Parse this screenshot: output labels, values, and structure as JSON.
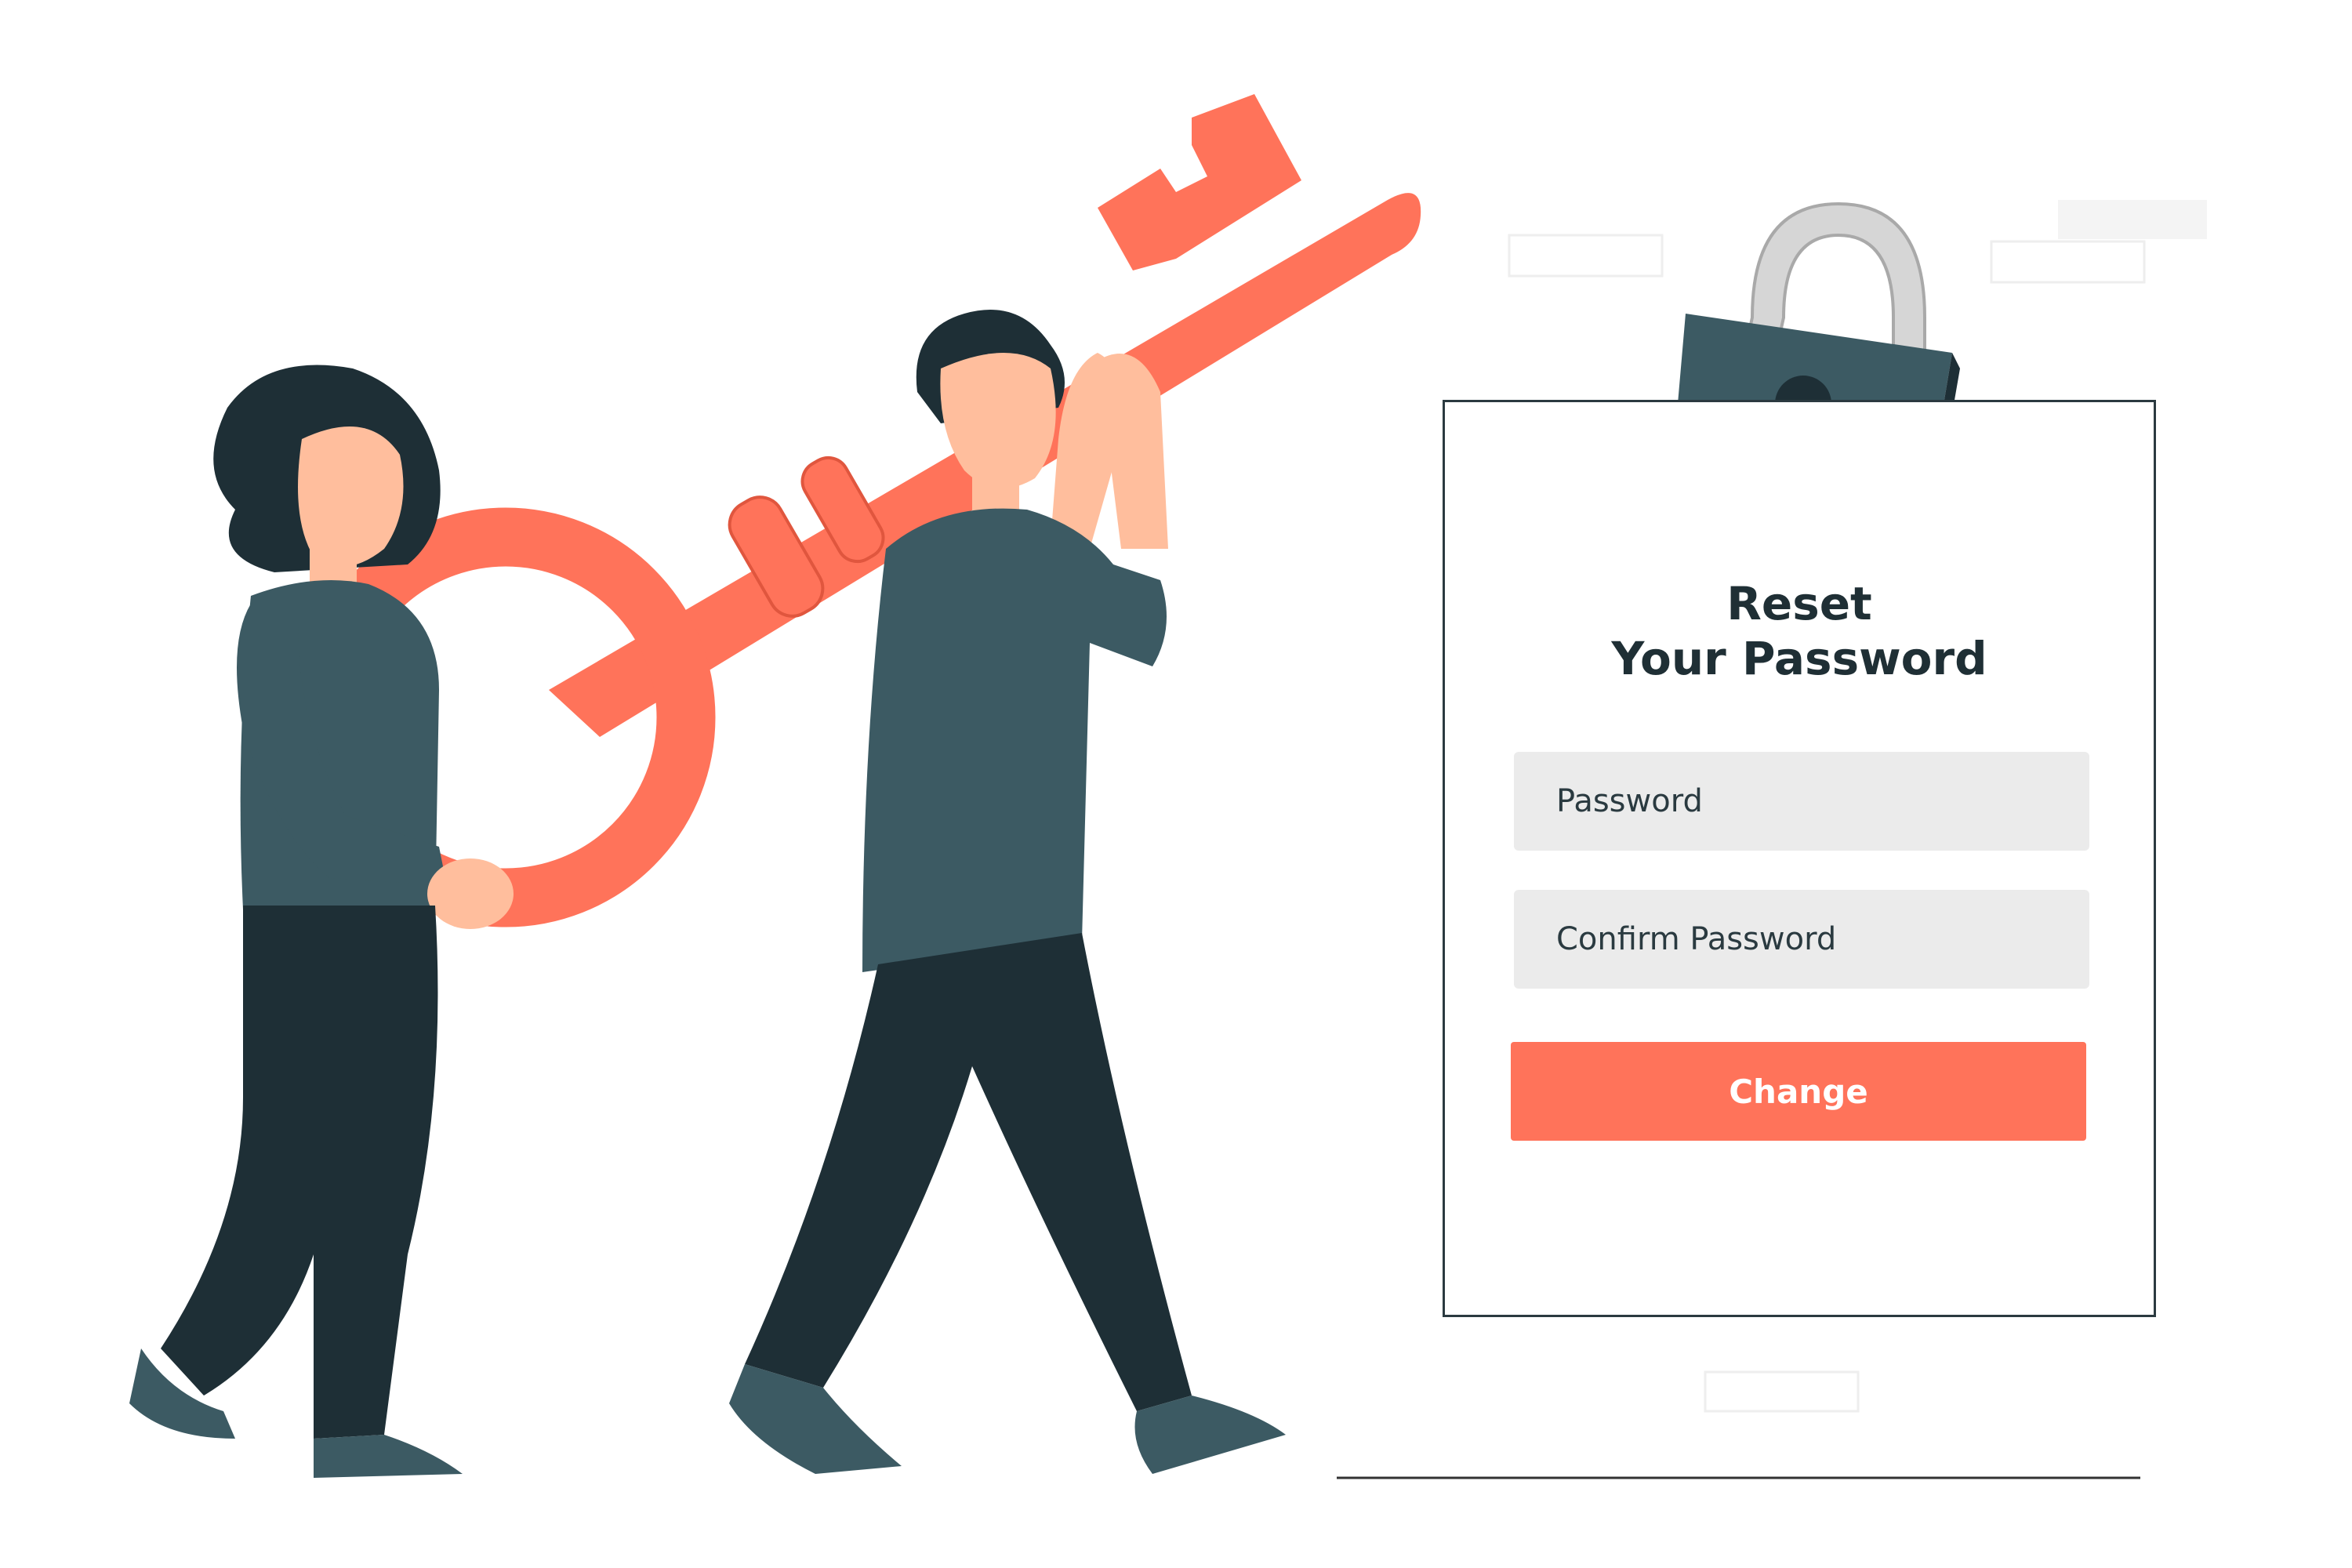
{
  "form": {
    "title_line1": "Reset",
    "title_line2": "Your Password",
    "password_placeholder": "Password",
    "confirm_placeholder": "Confirm Password",
    "submit_label": "Change"
  },
  "colors": {
    "accent": "#ff735a",
    "dark": "#1e2f36",
    "shirt": "#3c5a63",
    "skin": "#ffbe9d",
    "field_bg": "#ebebeb"
  },
  "icons": [
    "padlock-icon",
    "key-icon"
  ]
}
